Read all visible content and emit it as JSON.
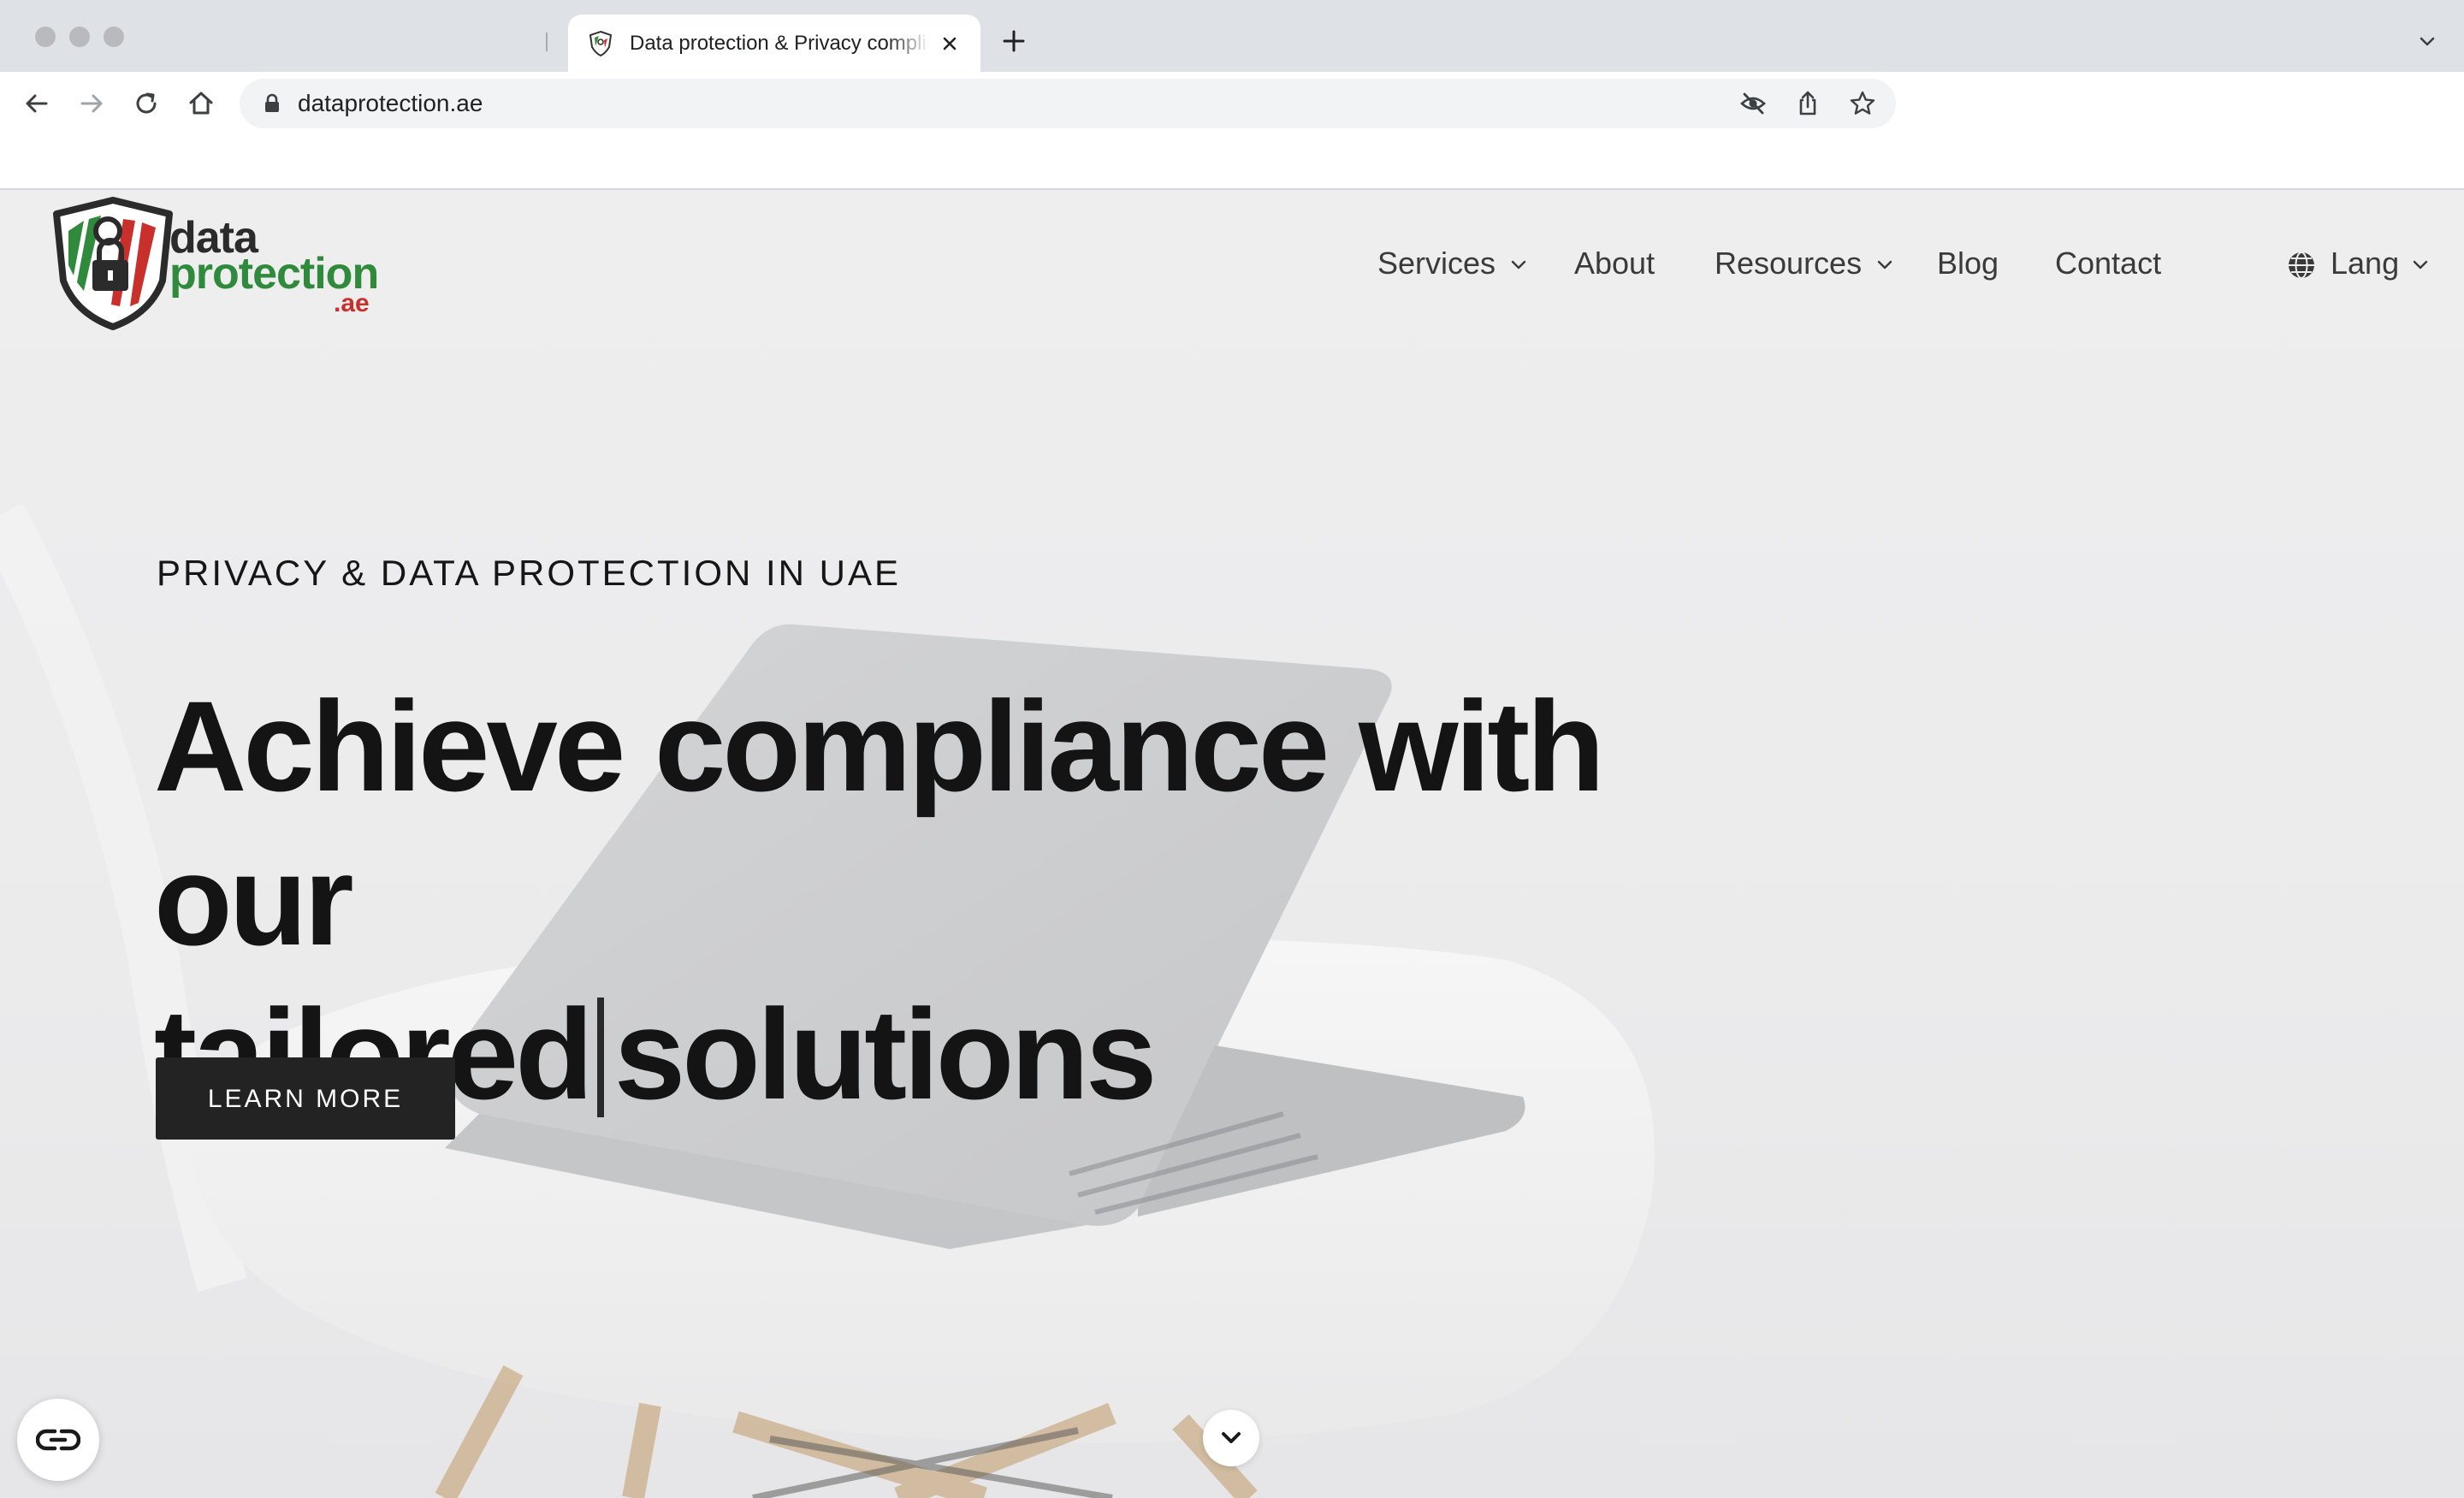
{
  "browser": {
    "tab_title": "Data protection & Privacy compliance",
    "url": "dataprotection.ae"
  },
  "site": {
    "logo": {
      "word1": "data",
      "word2": "protection",
      "word3": ".ae"
    },
    "nav": {
      "services": "Services",
      "about": "About",
      "resources": "Resources",
      "blog": "Blog",
      "contact": "Contact",
      "lang": "Lang"
    },
    "hero": {
      "eyebrow": "PRIVACY & DATA PROTECTION IN UAE",
      "headline_line1": "Achieve compliance with our",
      "headline_word_a": "tailored",
      "headline_word_b": "solutions",
      "cta": "LEARN MORE"
    }
  },
  "colors": {
    "logo_green": "#2f8a3b",
    "logo_red": "#c9302c",
    "cta_background": "#232323"
  },
  "icons": [
    "back-icon",
    "forward-icon",
    "reload-icon",
    "home-icon",
    "lock-icon",
    "eye-off-icon",
    "share-icon",
    "star-icon",
    "globe-icon",
    "chevron-down-icon",
    "accessibility-icon"
  ]
}
